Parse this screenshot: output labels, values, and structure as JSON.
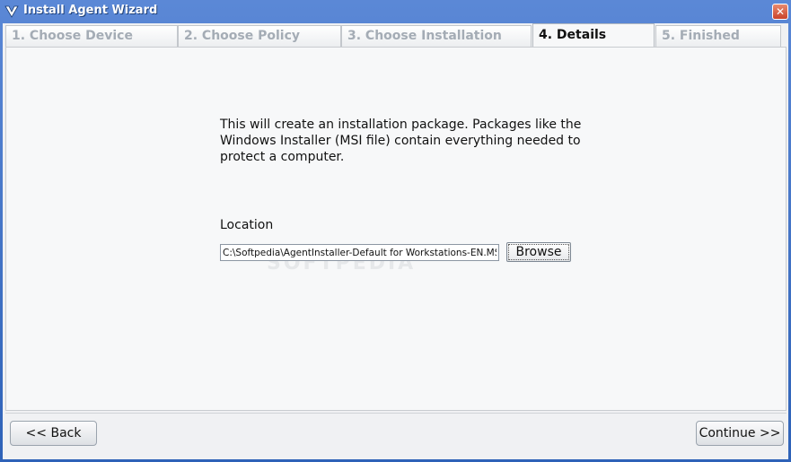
{
  "window": {
    "title": "Install Agent Wizard",
    "icon": "app-logo-icon",
    "close_glyph": "✕"
  },
  "tabs": [
    {
      "label": "1. Choose Device",
      "active": false
    },
    {
      "label": "2. Choose Policy",
      "active": false
    },
    {
      "label": "3. Choose Installation",
      "active": false
    },
    {
      "label": "4. Details",
      "active": true
    },
    {
      "label": "5. Finished",
      "active": false
    }
  ],
  "details": {
    "intro_line1": "This will create an installation package. Packages like the",
    "intro_line2": "Windows Installer (MSI file) contain everything needed to",
    "intro_line3": "protect a computer.",
    "location_label": "Location",
    "location_value": "C:\\Softpedia\\AgentInstaller-Default for Workstations-EN.MSI",
    "browse_label": "Browse",
    "watermark": "SOFTPEDIA"
  },
  "footer": {
    "back_label": "<< Back",
    "continue_label": "Continue >>"
  },
  "colors": {
    "titlebar": "#2e62b8",
    "active_tab_text": "#111111",
    "inactive_tab_text": "#a4acb5"
  }
}
